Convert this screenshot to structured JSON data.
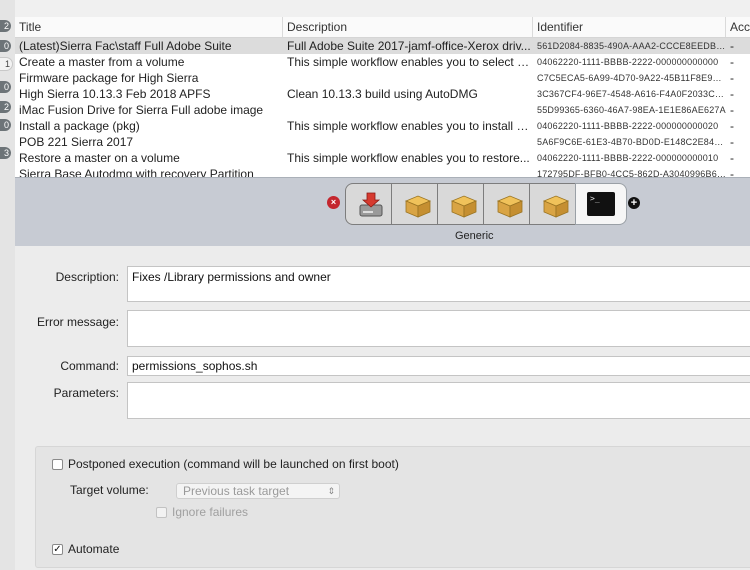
{
  "gutter": {
    "badges": [
      "2",
      "0",
      "1",
      "0",
      "2",
      "0",
      "3"
    ]
  },
  "table": {
    "columns": [
      "Title",
      "Description",
      "Identifier",
      "Acc"
    ],
    "rows": [
      {
        "title": "(Latest)Sierra Fac\\staff Full Adobe Suite",
        "description": "Full Adobe Suite 2017-jamf-office-Xerox driv...",
        "identifier": "561D2084-8835-490A-AAA2-CCCE8EEDBF...",
        "acc": "-",
        "selected": true
      },
      {
        "title": "Create a master from a volume",
        "description": "This simple workflow enables you to select a...",
        "identifier": "04062220-1111-BBBB-2222-000000000000",
        "acc": "-"
      },
      {
        "title": "Firmware package for High Sierra",
        "description": "",
        "identifier": "C7C5ECA5-6A99-4D70-9A22-45B11F8E98C0",
        "acc": "-"
      },
      {
        "title": "High Sierra 10.13.3 Feb 2018 APFS",
        "description": "Clean 10.13.3 build using AutoDMG",
        "identifier": "3C367CF4-96E7-4548-A616-F4A0F2033C0D",
        "acc": "-"
      },
      {
        "title": "iMac Fusion Drive for  Sierra Full adobe image",
        "description": "",
        "identifier": "55D99365-6360-46A7-98EA-1E1E86AE627A",
        "acc": "-"
      },
      {
        "title": "Install a package (pkg)",
        "description": "This simple workflow enables you to install a...",
        "identifier": "04062220-1111-BBBB-2222-000000000020",
        "acc": "-"
      },
      {
        "title": "POB 221 Sierra 2017",
        "description": "",
        "identifier": "5A6F9C6E-61E3-4B70-BD0D-E148C2E840BC",
        "acc": "-"
      },
      {
        "title": "Restore a master on a volume",
        "description": "This simple workflow enables you to restore...",
        "identifier": "04062220-1111-BBBB-2222-000000000010",
        "acc": "-"
      },
      {
        "title": "Sierra Base Autodmg with recovery Partition",
        "description": "",
        "identifier": "172795DF-BFB0-4CC5-862D-A3040996B646",
        "acc": "-"
      }
    ]
  },
  "workflow": {
    "steps": [
      "download-disk-icon",
      "package-icon",
      "package-icon",
      "package-icon",
      "package-icon",
      "terminal-icon"
    ],
    "selected_step_label": "Generic",
    "terminal_glyph": ">_",
    "remove_glyph": "×",
    "add_glyph": "+"
  },
  "form": {
    "description_label": "Description:",
    "description_value": "Fixes /Library permissions and owner",
    "error_label": "Error message:",
    "error_value": "",
    "command_label": "Command:",
    "command_value": "permissions_sophos.sh",
    "parameters_label": "Parameters:",
    "parameters_value": "",
    "postponed_label": "Postponed execution (command will be launched on first boot)",
    "target_volume_label": "Target volume:",
    "target_volume_value": "Previous task target",
    "ignore_failures_label": "Ignore failures",
    "automate_label": "Automate",
    "automate_checked": "✓"
  }
}
